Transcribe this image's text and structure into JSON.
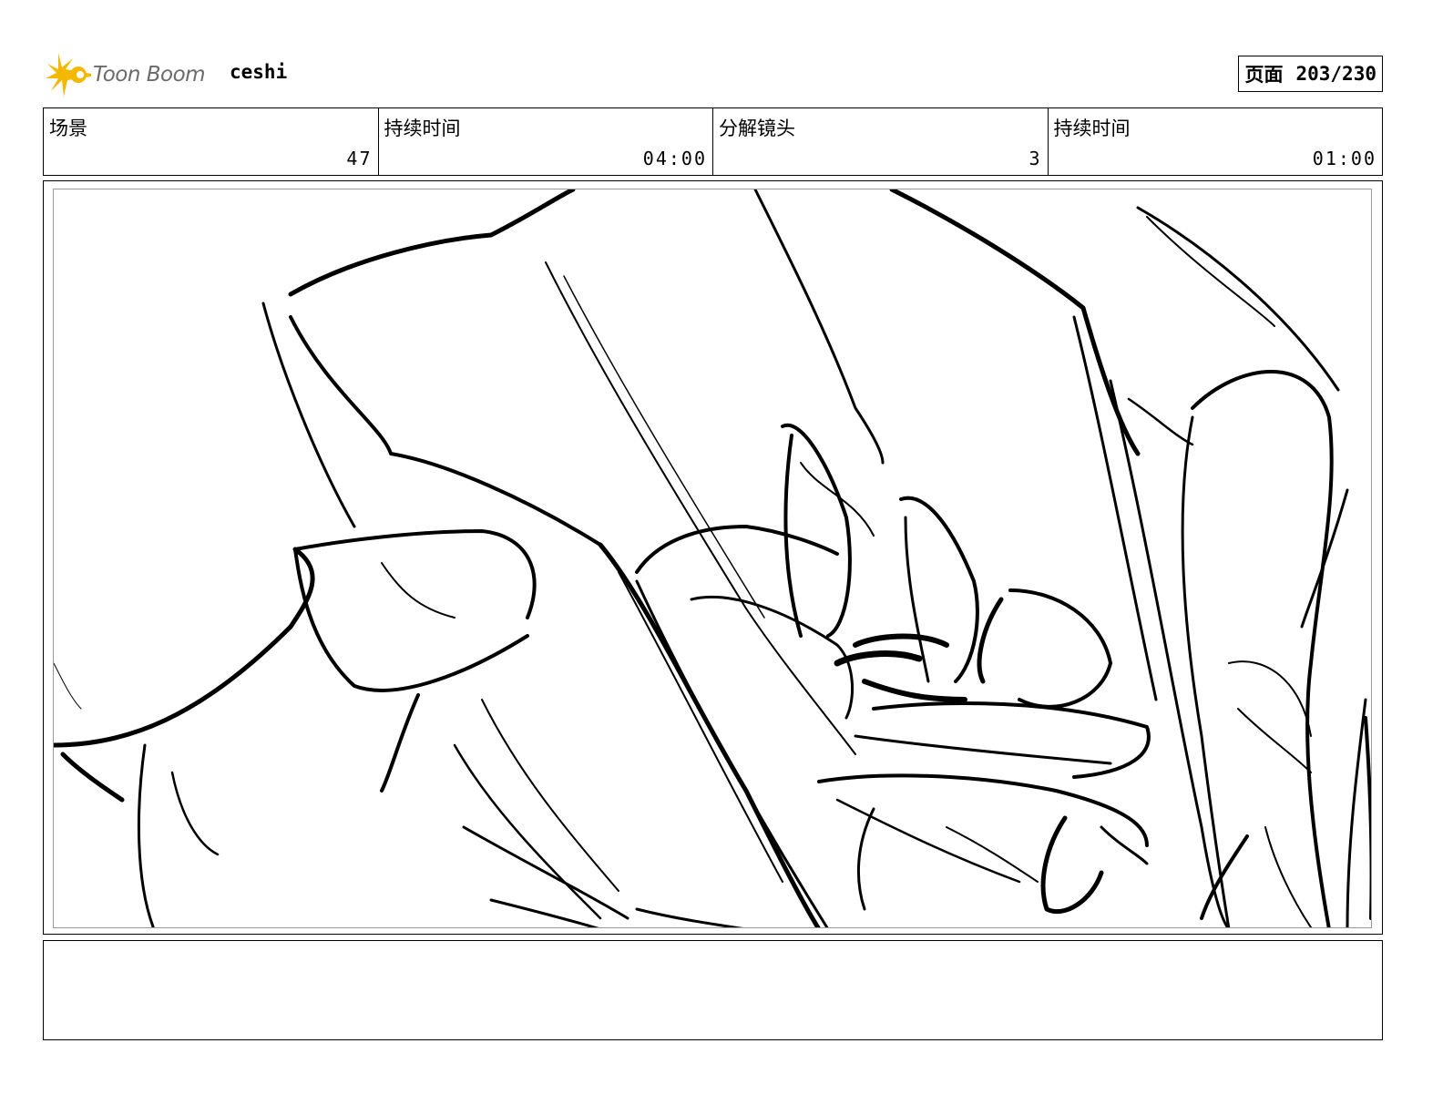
{
  "header": {
    "logo_text": "Toon Boom",
    "project_name": "ceshi",
    "page_label": "页面",
    "page_number": "203/230"
  },
  "info": {
    "scene_label": "场景",
    "scene_value": "47",
    "scene_duration_label": "持续时间",
    "scene_duration_value": "04:00",
    "panel_label": "分解镜头",
    "panel_value": "3",
    "panel_duration_label": "持续时间",
    "panel_duration_value": "01:00"
  },
  "panel": {
    "image_icon": "sketch-drawing-hands-icon"
  },
  "notes": {
    "text": ""
  },
  "colors": {
    "logo_star": "#f5b800",
    "logo_text": "#6b6b6b",
    "frame_line": "#000000",
    "safe_area_line": "#9a9a9a"
  }
}
